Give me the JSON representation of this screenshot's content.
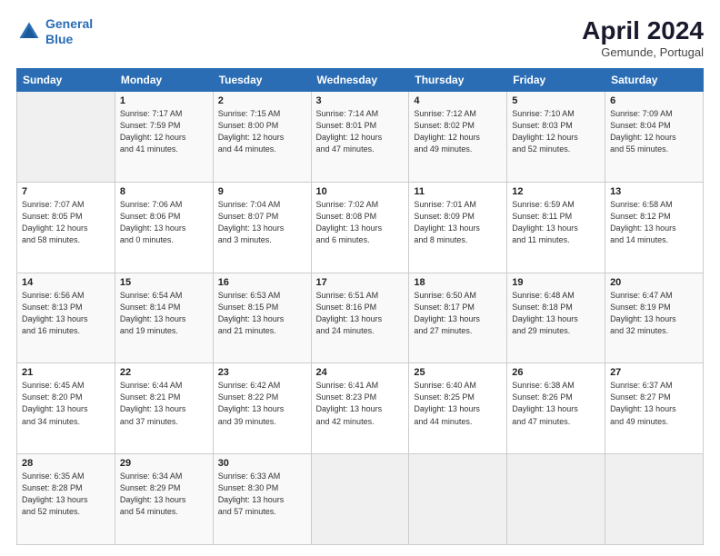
{
  "logo": {
    "line1": "General",
    "line2": "Blue"
  },
  "title": "April 2024",
  "subtitle": "Gemunde, Portugal",
  "header_days": [
    "Sunday",
    "Monday",
    "Tuesday",
    "Wednesday",
    "Thursday",
    "Friday",
    "Saturday"
  ],
  "weeks": [
    [
      {
        "day": "",
        "info": ""
      },
      {
        "day": "1",
        "info": "Sunrise: 7:17 AM\nSunset: 7:59 PM\nDaylight: 12 hours\nand 41 minutes."
      },
      {
        "day": "2",
        "info": "Sunrise: 7:15 AM\nSunset: 8:00 PM\nDaylight: 12 hours\nand 44 minutes."
      },
      {
        "day": "3",
        "info": "Sunrise: 7:14 AM\nSunset: 8:01 PM\nDaylight: 12 hours\nand 47 minutes."
      },
      {
        "day": "4",
        "info": "Sunrise: 7:12 AM\nSunset: 8:02 PM\nDaylight: 12 hours\nand 49 minutes."
      },
      {
        "day": "5",
        "info": "Sunrise: 7:10 AM\nSunset: 8:03 PM\nDaylight: 12 hours\nand 52 minutes."
      },
      {
        "day": "6",
        "info": "Sunrise: 7:09 AM\nSunset: 8:04 PM\nDaylight: 12 hours\nand 55 minutes."
      }
    ],
    [
      {
        "day": "7",
        "info": "Sunrise: 7:07 AM\nSunset: 8:05 PM\nDaylight: 12 hours\nand 58 minutes."
      },
      {
        "day": "8",
        "info": "Sunrise: 7:06 AM\nSunset: 8:06 PM\nDaylight: 13 hours\nand 0 minutes."
      },
      {
        "day": "9",
        "info": "Sunrise: 7:04 AM\nSunset: 8:07 PM\nDaylight: 13 hours\nand 3 minutes."
      },
      {
        "day": "10",
        "info": "Sunrise: 7:02 AM\nSunset: 8:08 PM\nDaylight: 13 hours\nand 6 minutes."
      },
      {
        "day": "11",
        "info": "Sunrise: 7:01 AM\nSunset: 8:09 PM\nDaylight: 13 hours\nand 8 minutes."
      },
      {
        "day": "12",
        "info": "Sunrise: 6:59 AM\nSunset: 8:11 PM\nDaylight: 13 hours\nand 11 minutes."
      },
      {
        "day": "13",
        "info": "Sunrise: 6:58 AM\nSunset: 8:12 PM\nDaylight: 13 hours\nand 14 minutes."
      }
    ],
    [
      {
        "day": "14",
        "info": "Sunrise: 6:56 AM\nSunset: 8:13 PM\nDaylight: 13 hours\nand 16 minutes."
      },
      {
        "day": "15",
        "info": "Sunrise: 6:54 AM\nSunset: 8:14 PM\nDaylight: 13 hours\nand 19 minutes."
      },
      {
        "day": "16",
        "info": "Sunrise: 6:53 AM\nSunset: 8:15 PM\nDaylight: 13 hours\nand 21 minutes."
      },
      {
        "day": "17",
        "info": "Sunrise: 6:51 AM\nSunset: 8:16 PM\nDaylight: 13 hours\nand 24 minutes."
      },
      {
        "day": "18",
        "info": "Sunrise: 6:50 AM\nSunset: 8:17 PM\nDaylight: 13 hours\nand 27 minutes."
      },
      {
        "day": "19",
        "info": "Sunrise: 6:48 AM\nSunset: 8:18 PM\nDaylight: 13 hours\nand 29 minutes."
      },
      {
        "day": "20",
        "info": "Sunrise: 6:47 AM\nSunset: 8:19 PM\nDaylight: 13 hours\nand 32 minutes."
      }
    ],
    [
      {
        "day": "21",
        "info": "Sunrise: 6:45 AM\nSunset: 8:20 PM\nDaylight: 13 hours\nand 34 minutes."
      },
      {
        "day": "22",
        "info": "Sunrise: 6:44 AM\nSunset: 8:21 PM\nDaylight: 13 hours\nand 37 minutes."
      },
      {
        "day": "23",
        "info": "Sunrise: 6:42 AM\nSunset: 8:22 PM\nDaylight: 13 hours\nand 39 minutes."
      },
      {
        "day": "24",
        "info": "Sunrise: 6:41 AM\nSunset: 8:23 PM\nDaylight: 13 hours\nand 42 minutes."
      },
      {
        "day": "25",
        "info": "Sunrise: 6:40 AM\nSunset: 8:25 PM\nDaylight: 13 hours\nand 44 minutes."
      },
      {
        "day": "26",
        "info": "Sunrise: 6:38 AM\nSunset: 8:26 PM\nDaylight: 13 hours\nand 47 minutes."
      },
      {
        "day": "27",
        "info": "Sunrise: 6:37 AM\nSunset: 8:27 PM\nDaylight: 13 hours\nand 49 minutes."
      }
    ],
    [
      {
        "day": "28",
        "info": "Sunrise: 6:35 AM\nSunset: 8:28 PM\nDaylight: 13 hours\nand 52 minutes."
      },
      {
        "day": "29",
        "info": "Sunrise: 6:34 AM\nSunset: 8:29 PM\nDaylight: 13 hours\nand 54 minutes."
      },
      {
        "day": "30",
        "info": "Sunrise: 6:33 AM\nSunset: 8:30 PM\nDaylight: 13 hours\nand 57 minutes."
      },
      {
        "day": "",
        "info": ""
      },
      {
        "day": "",
        "info": ""
      },
      {
        "day": "",
        "info": ""
      },
      {
        "day": "",
        "info": ""
      }
    ]
  ]
}
